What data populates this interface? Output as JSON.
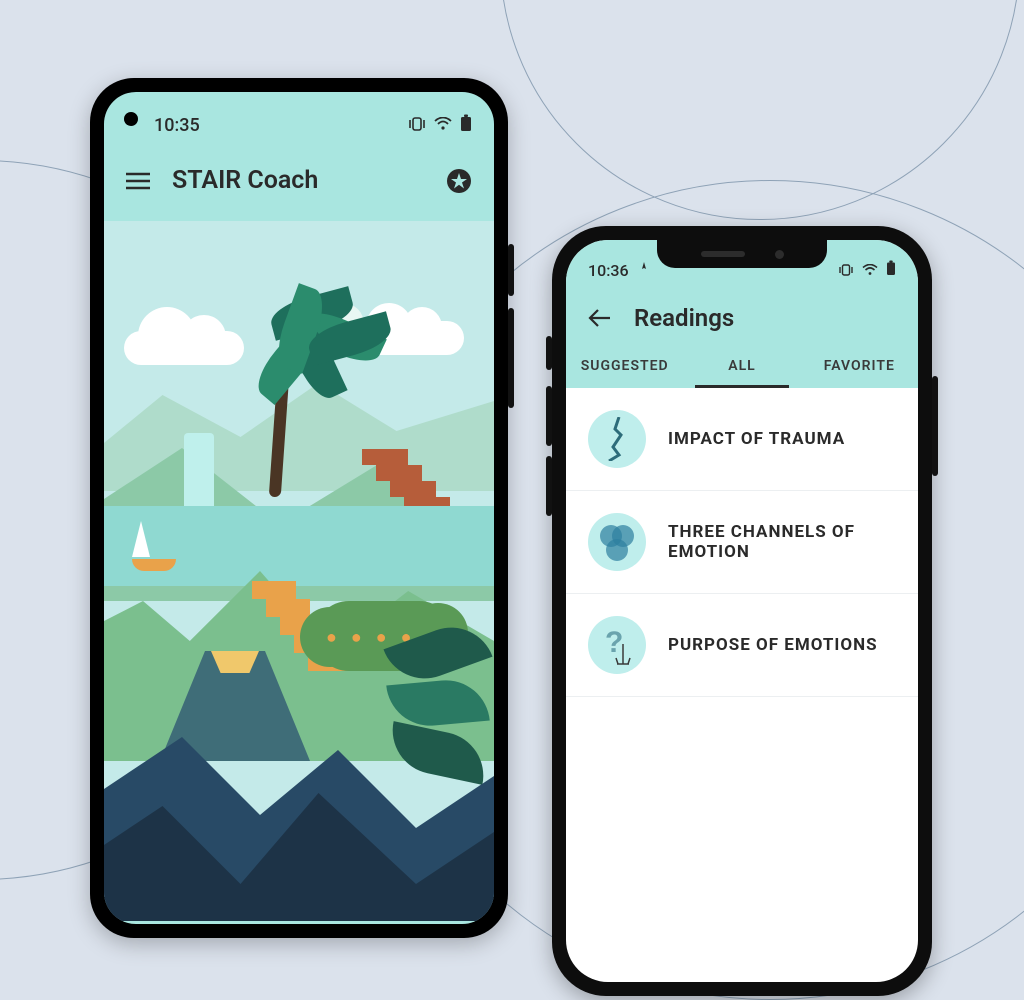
{
  "android": {
    "status": {
      "time": "10:35"
    },
    "header": {
      "app_title": "STAIR Coach"
    }
  },
  "ios": {
    "status": {
      "time": "10:36"
    },
    "header": {
      "title": "Readings"
    },
    "tabs": {
      "suggested": "SUGGESTED",
      "all": "ALL",
      "favorite": "FAVORITE"
    },
    "readings": [
      {
        "label": "IMPACT OF TRAUMA",
        "icon": "crack-icon"
      },
      {
        "label": "THREE CHANNELS OF EMOTION",
        "icon": "venn-icon"
      },
      {
        "label": "PURPOSE OF EMOTIONS",
        "icon": "question-icon"
      }
    ]
  }
}
